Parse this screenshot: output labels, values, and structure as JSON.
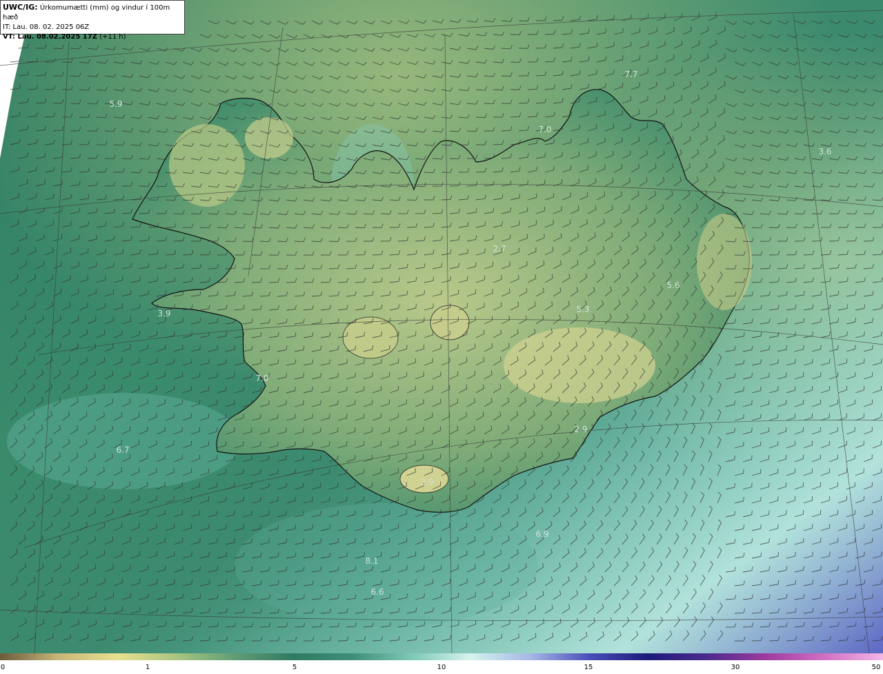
{
  "header": {
    "model": "UWC/IG:",
    "title": "Úrkomumætti (mm) og vindur í 100m hæð",
    "issue_time": "IT: Lau. 08. 02. 2025 06Z",
    "valid_label": "VT: Lau. 08.02.2025 17Z",
    "valid_offset": "(+11 h)"
  },
  "map_labels": [
    {
      "id": "nw-sea",
      "text": "5.9"
    },
    {
      "id": "north-sea",
      "text": "7.7"
    },
    {
      "id": "north-coast",
      "text": "7.0"
    },
    {
      "id": "ne-sea",
      "text": "3.6"
    },
    {
      "id": "interior",
      "text": "2.7"
    },
    {
      "id": "east",
      "text": "5.6"
    },
    {
      "id": "central",
      "text": "5.3"
    },
    {
      "id": "snaefellsnes",
      "text": "3.9"
    },
    {
      "id": "reykjanes",
      "text": "7.0"
    },
    {
      "id": "sw-sea",
      "text": "6.7"
    },
    {
      "id": "southeast",
      "text": "2.9"
    },
    {
      "id": "south",
      "text": "2.9"
    },
    {
      "id": "south-sea-1",
      "text": "8.1"
    },
    {
      "id": "south-sea-2",
      "text": "6.6"
    },
    {
      "id": "south-sea-3",
      "text": "6.9"
    }
  ],
  "colorbar": {
    "ticks": [
      "0",
      "1",
      "5",
      "10",
      "15",
      "30",
      "50"
    ],
    "colors": [
      "#6b5a3a",
      "#c9b77a",
      "#e8e08f",
      "#a9c581",
      "#5f9c75",
      "#2f7a62",
      "#3f8f78",
      "#7ec9b6",
      "#d6f3ee",
      "#a7b8e6",
      "#4a4fb8",
      "#1c1a7a",
      "#4b2a8c",
      "#9e3a9e",
      "#d16fc2",
      "#f3b6e6"
    ]
  },
  "colors": {
    "sea": "#2f7a62",
    "land_low": "#3e8b6b",
    "land_high": "#b9c98a",
    "barb": "#333333",
    "coast": "#111111"
  }
}
